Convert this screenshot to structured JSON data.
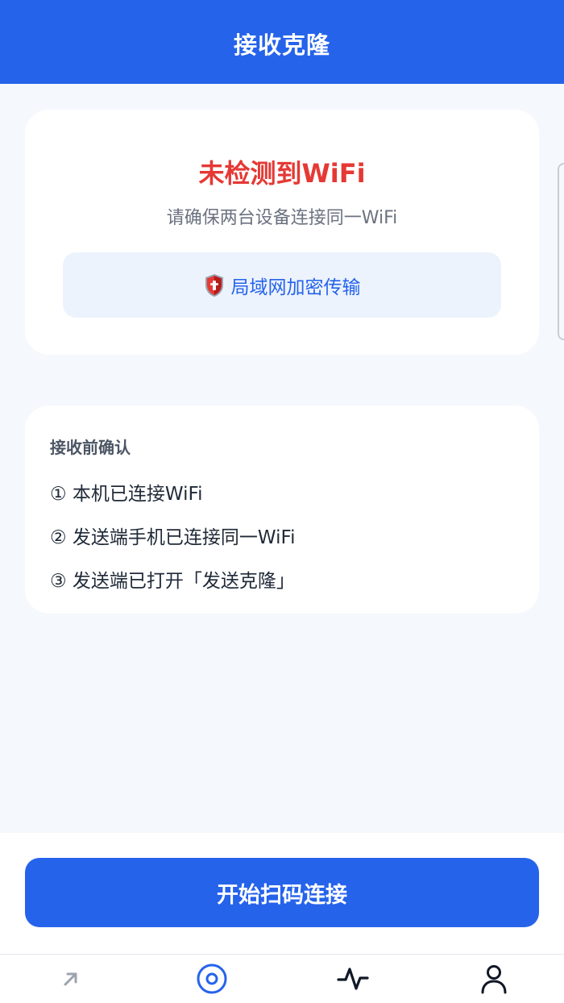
{
  "header": {
    "title": "接收克隆"
  },
  "status": {
    "title": "未检测到WiFi",
    "subtitle": "请确保两台设备连接同一WiFi",
    "lan_label": "局域网加密传输",
    "colors": {
      "title": "#e53935",
      "accent": "#2563eb"
    }
  },
  "confirm": {
    "heading": "接收前确认",
    "items": [
      "① 本机已连接WiFi",
      "② 发送端手机已连接同一WiFi",
      "③ 发送端已打开「发送克隆」"
    ]
  },
  "action": {
    "scan_button": "开始扫码连接"
  },
  "tabbar": {
    "tabs": [
      {
        "icon": "arrow-up-right-icon",
        "active": false
      },
      {
        "icon": "target-circle-icon",
        "active": true
      },
      {
        "icon": "activity-pulse-icon",
        "active": false
      },
      {
        "icon": "user-icon",
        "active": false
      }
    ]
  }
}
